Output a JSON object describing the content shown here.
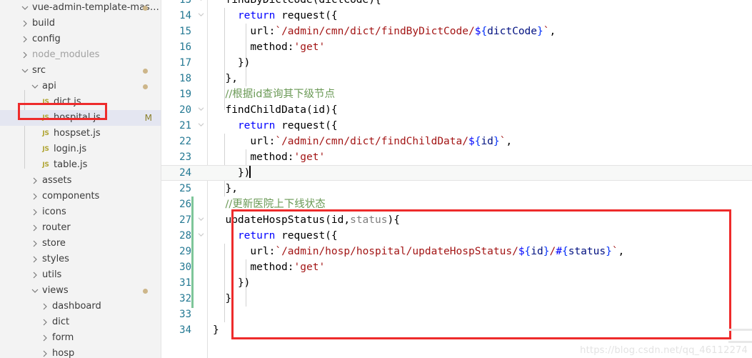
{
  "window": {
    "title": "vue-admin-template-master",
    "watermark": "https://blog.csdn.net/qq_46112274"
  },
  "sidebar": {
    "root": {
      "label": "vue-admin-template-master",
      "expanded": true,
      "modified_dot": true
    },
    "items": [
      {
        "label": "build",
        "type": "folder",
        "expanded": false,
        "depth": 1,
        "dim": false,
        "dot": false,
        "badge": ""
      },
      {
        "label": "config",
        "type": "folder",
        "expanded": false,
        "depth": 1,
        "dim": false,
        "dot": false,
        "badge": ""
      },
      {
        "label": "node_modules",
        "type": "folder",
        "expanded": false,
        "depth": 1,
        "dim": true,
        "dot": false,
        "badge": ""
      },
      {
        "label": "src",
        "type": "folder",
        "expanded": true,
        "depth": 1,
        "dim": false,
        "dot": true,
        "badge": ""
      },
      {
        "label": "api",
        "type": "folder",
        "expanded": true,
        "depth": 2,
        "dim": false,
        "dot": true,
        "badge": ""
      },
      {
        "label": "dict.js",
        "type": "file",
        "icon": "JS",
        "depth": 3,
        "dim": false,
        "dot": false,
        "badge": ""
      },
      {
        "label": "hospital.js",
        "type": "file",
        "icon": "JS",
        "depth": 3,
        "dim": false,
        "dot": false,
        "badge": "M",
        "selected": true,
        "highlighted": true
      },
      {
        "label": "hospset.js",
        "type": "file",
        "icon": "JS",
        "depth": 3,
        "dim": false,
        "dot": false,
        "badge": ""
      },
      {
        "label": "login.js",
        "type": "file",
        "icon": "JS",
        "depth": 3,
        "dim": false,
        "dot": false,
        "badge": ""
      },
      {
        "label": "table.js",
        "type": "file",
        "icon": "JS",
        "depth": 3,
        "dim": false,
        "dot": false,
        "badge": ""
      },
      {
        "label": "assets",
        "type": "folder",
        "expanded": false,
        "depth": 2,
        "dim": false,
        "dot": false,
        "badge": ""
      },
      {
        "label": "components",
        "type": "folder",
        "expanded": false,
        "depth": 2,
        "dim": false,
        "dot": false,
        "badge": ""
      },
      {
        "label": "icons",
        "type": "folder",
        "expanded": false,
        "depth": 2,
        "dim": false,
        "dot": false,
        "badge": ""
      },
      {
        "label": "router",
        "type": "folder",
        "expanded": false,
        "depth": 2,
        "dim": false,
        "dot": false,
        "badge": ""
      },
      {
        "label": "store",
        "type": "folder",
        "expanded": false,
        "depth": 2,
        "dim": false,
        "dot": false,
        "badge": ""
      },
      {
        "label": "styles",
        "type": "folder",
        "expanded": false,
        "depth": 2,
        "dim": false,
        "dot": false,
        "badge": ""
      },
      {
        "label": "utils",
        "type": "folder",
        "expanded": false,
        "depth": 2,
        "dim": false,
        "dot": false,
        "badge": ""
      },
      {
        "label": "views",
        "type": "folder",
        "expanded": true,
        "depth": 2,
        "dim": false,
        "dot": true,
        "badge": ""
      },
      {
        "label": "dashboard",
        "type": "folder",
        "expanded": false,
        "depth": 3,
        "dim": false,
        "dot": false,
        "badge": ""
      },
      {
        "label": "dict",
        "type": "folder",
        "expanded": false,
        "depth": 3,
        "dim": false,
        "dot": false,
        "badge": ""
      },
      {
        "label": "form",
        "type": "folder",
        "expanded": false,
        "depth": 3,
        "dim": false,
        "dot": false,
        "badge": ""
      },
      {
        "label": "hosp",
        "type": "folder",
        "expanded": false,
        "depth": 3,
        "dim": false,
        "dot": false,
        "badge": ""
      }
    ]
  },
  "editor": {
    "first_visible_line": 13,
    "current_line": 24,
    "git_modified_lines": [
      25,
      26,
      27,
      28,
      29,
      30,
      31
    ],
    "lines": [
      {
        "n": 13,
        "fold": "open",
        "clipped_top": true,
        "text": "  findByDictCode(dictCode){"
      },
      {
        "n": 14,
        "fold": "open",
        "text": "    return request({"
      },
      {
        "n": 15,
        "fold": "",
        "text": "      url:`/admin/cmn/dict/findByDictCode/${dictCode}`,"
      },
      {
        "n": 16,
        "fold": "",
        "text": "      method:'get'"
      },
      {
        "n": 17,
        "fold": "",
        "text": "    })"
      },
      {
        "n": 18,
        "fold": "",
        "text": "  },"
      },
      {
        "n": 19,
        "fold": "",
        "text": "  //根据id查询其下级节点"
      },
      {
        "n": 20,
        "fold": "open",
        "text": "  findChildData(id){"
      },
      {
        "n": 21,
        "fold": "open",
        "text": "    return request({"
      },
      {
        "n": 22,
        "fold": "",
        "text": "      url:`/admin/cmn/dict/findChildData/${id}`,"
      },
      {
        "n": 23,
        "fold": "",
        "text": "      method:'get'"
      },
      {
        "n": 24,
        "fold": "",
        "text": "    })"
      },
      {
        "n": 25,
        "fold": "",
        "text": "  },"
      },
      {
        "n": 26,
        "fold": "",
        "text": "  //更新医院上下线状态"
      },
      {
        "n": 27,
        "fold": "open",
        "text": "  updateHospStatus(id,status){"
      },
      {
        "n": 28,
        "fold": "open",
        "text": "    return request({"
      },
      {
        "n": 29,
        "fold": "",
        "text": "      url:`/admin/hosp/hospital/updateHospStatus/${id}/#{status}`,"
      },
      {
        "n": 30,
        "fold": "",
        "text": "      method:'get'"
      },
      {
        "n": 31,
        "fold": "",
        "text": "    })"
      },
      {
        "n": 32,
        "fold": "",
        "text": "  }"
      },
      {
        "n": 33,
        "fold": "",
        "text": ""
      },
      {
        "n": 34,
        "fold": "",
        "clipped_bottom": true,
        "text": "}"
      }
    ]
  },
  "annotations": {
    "sidebar_highlight": {
      "target": "hospital.js",
      "color": "#ee2b2b"
    },
    "code_highlight": {
      "from_line": 26,
      "to_line": 32,
      "color": "#ee2b2b"
    }
  },
  "colors": {
    "accent_red": "#ee2b2b",
    "keyword_blue": "#0000ff",
    "string_red": "#a31515",
    "comment_green": "#6a9955",
    "gutter_blue": "#237893",
    "modified_dot": "#cdb68a",
    "git_added_green": "#7ec699",
    "selection_bg": "#e4e6f1"
  }
}
